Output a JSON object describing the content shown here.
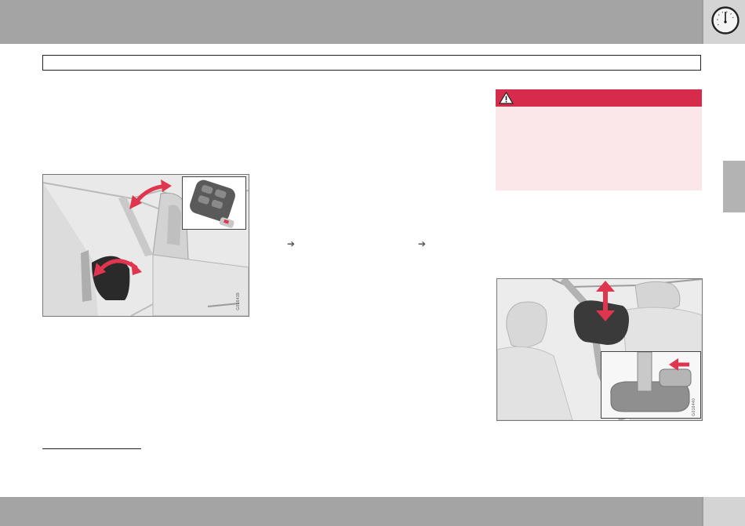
{
  "figures": {
    "mirror_fold": {
      "code": "G016439"
    },
    "headrest": {
      "code": "G016440"
    }
  },
  "inline_arrows": [
    "➔",
    "➔"
  ],
  "colors": {
    "header_gray": "#a4a4a4",
    "warning_red": "#d62b4b",
    "warning_bg": "#fbe6ea",
    "arrow_red": "#e0354f"
  },
  "icons": {
    "header": "speedometer-icon",
    "warning": "warning-triangle-icon"
  }
}
